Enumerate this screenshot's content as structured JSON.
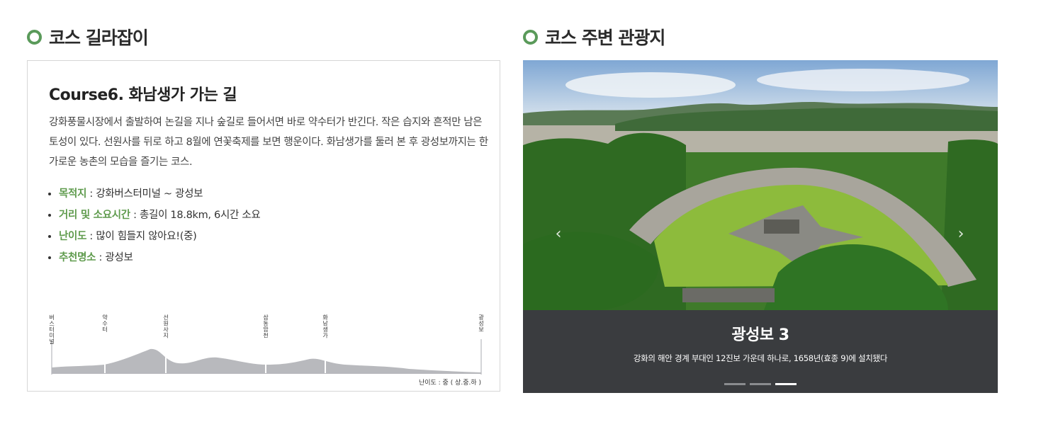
{
  "left_section": {
    "title": "코스 길라잡이"
  },
  "right_section": {
    "title": "코스 주변 관광지"
  },
  "course": {
    "heading": "Course6. 화남생가 가는 길",
    "description": "강화풍물시장에서 출발하여 논길을 지나 숲길로 들어서면 바로 약수터가 반긴다. 작은 습지와 흔적만 남은 토성이 있다. 선원사를 뒤로 하고 8월에 연꽃축제를 보면 행운이다. 화남생가를 둘러 본 후 광성보까지는 한가로운 농촌의 모습을 즐기는 코스.",
    "info": [
      {
        "label": "목적지",
        "value": " : 강화버스터미널 ~ 광성보"
      },
      {
        "label": "거리 및 소요시간",
        "value": " : 총길이 18.8km, 6시간 소요"
      },
      {
        "label": "난이도",
        "value": " : 많이 힘들지 않아요!(중)"
      },
      {
        "label": "추천명소",
        "value": " : 광성보"
      }
    ],
    "profile_stops": [
      "버스터미널",
      "약수터",
      "선원사지",
      "삼동암천",
      "화남생가",
      "광성보"
    ],
    "difficulty_note": "난이도 : 중 ( 상.중.하 )"
  },
  "slider": {
    "title": "광성보 3",
    "subtitle": "강화의 해안 경계 부대인 12진보 가운데 하나로, 1658년(효종 9)에 설치됐다",
    "total_slides": 3,
    "active_slide": 3,
    "prev_icon": "chevron-left-icon",
    "next_icon": "chevron-right-icon"
  },
  "colors": {
    "accent_green": "#5a9a5a",
    "label_green": "#5f9b4d",
    "caption_bg": "#3a3c3f"
  }
}
